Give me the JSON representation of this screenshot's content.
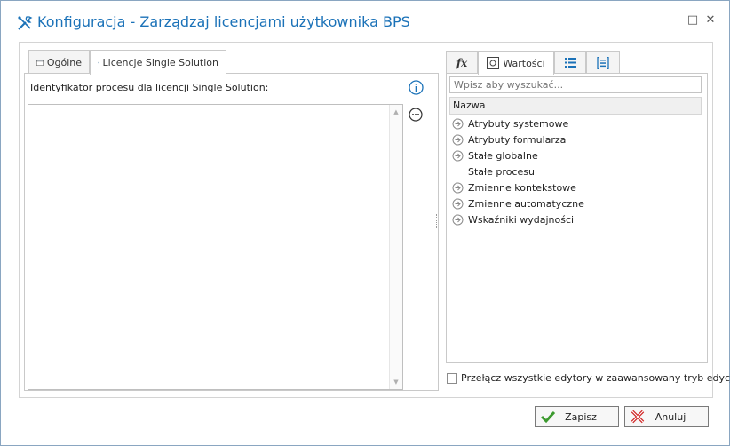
{
  "window": {
    "title": "Konfiguracja - Zarządzaj licencjami użytkownika BPS",
    "maximize_glyph": "□",
    "close_glyph": "✕"
  },
  "left_tabs": [
    {
      "label": "Ogólne",
      "icon": "window-icon",
      "active": false
    },
    {
      "label": "Licencje Single Solution",
      "icon": "user-license-icon",
      "active": true
    }
  ],
  "field": {
    "label": "Identyfikator procesu dla licencji Single Solution:",
    "value": ""
  },
  "right_tabs": [
    {
      "label": "",
      "icon": "function-icon",
      "glyph": "fx",
      "active": false
    },
    {
      "label": "Wartości",
      "icon": "values-icon",
      "active": true
    },
    {
      "label": "",
      "icon": "list-icon",
      "active": false
    },
    {
      "label": "",
      "icon": "form-icon",
      "active": false
    }
  ],
  "search": {
    "placeholder": "Wpisz aby wyszukać..."
  },
  "list": {
    "header": "Nazwa",
    "items": [
      {
        "label": "Atrybuty systemowe",
        "expandable": true
      },
      {
        "label": "Atrybuty formularza",
        "expandable": true
      },
      {
        "label": "Stałe globalne",
        "expandable": true
      },
      {
        "label": "Stałe procesu",
        "expandable": false
      },
      {
        "label": "Zmienne kontekstowe",
        "expandable": true
      },
      {
        "label": "Zmienne automatyczne",
        "expandable": true
      },
      {
        "label": "Wskaźniki wydajności",
        "expandable": true
      }
    ]
  },
  "advanced_toggle": {
    "label": "Przełącz wszystkie edytory w zaawansowany tryb edycji",
    "checked": false
  },
  "buttons": {
    "save_label": "Zapisz",
    "cancel_label": "Anuluj"
  },
  "colors": {
    "accent": "#1b72b8",
    "save_check": "#3c9a2f",
    "cancel_x": "#d02626"
  }
}
